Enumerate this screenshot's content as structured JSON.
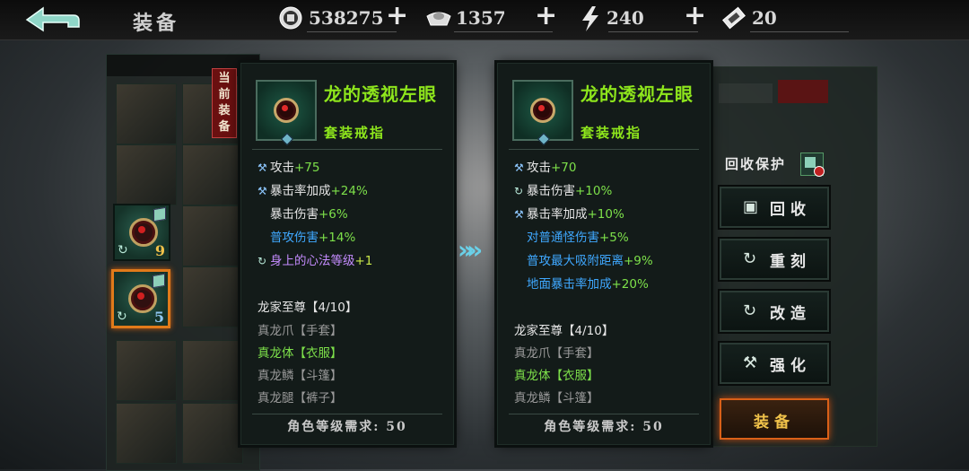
{
  "header": {
    "title": "装备",
    "resources": [
      {
        "icon": "coin-icon",
        "value": "538275"
      },
      {
        "icon": "ingot-icon",
        "value": "1357"
      },
      {
        "icon": "lightning-icon",
        "value": "240"
      },
      {
        "icon": "ticket-icon",
        "value": "20"
      }
    ]
  },
  "equipped_slots": [
    {
      "level": "9"
    },
    {
      "level": "5"
    }
  ],
  "current_tag": [
    "当",
    "前",
    "装",
    "备"
  ],
  "current_item": {
    "name": "龙的透视左眼",
    "type": "套装戒指",
    "stats": [
      {
        "label": "攻击",
        "value": "+75"
      },
      {
        "label": "暴击率加成",
        "value": "+24%"
      },
      {
        "label": "暴击伤害",
        "value": "+6%"
      },
      {
        "label": "普攻伤害",
        "value": "+14%"
      },
      {
        "label": "身上的心法等级",
        "value": "+1"
      }
    ],
    "set_title": "龙家至尊【4/10】",
    "set_items": [
      "真龙爪【手套】",
      "真龙体【衣服】",
      "真龙鳞【斗篷】",
      "真龙腿【裤子】"
    ],
    "requirement": "角色等级需求: 50"
  },
  "compare_item": {
    "name": "龙的透视左眼",
    "type": "套装戒指",
    "stats": [
      {
        "label": "攻击",
        "value": "+70"
      },
      {
        "label": "暴击伤害",
        "value": "+10%"
      },
      {
        "label": "暴击率加成",
        "value": "+10%"
      },
      {
        "label": "对普通怪伤害",
        "value": "+5%"
      },
      {
        "label": "普攻最大吸附距离",
        "value": "+9%"
      },
      {
        "label": "地面暴击率加成",
        "value": "+20%"
      }
    ],
    "set_title": "龙家至尊【4/10】",
    "set_items": [
      "真龙爪【手套】",
      "真龙体【衣服】",
      "真龙鳞【斗篷】"
    ],
    "requirement": "角色等级需求: 50"
  },
  "actions": {
    "protect_label": "回收保护",
    "recycle": "回收",
    "reforge": "重刻",
    "rebuild": "改造",
    "enhance": "强化",
    "equip": "装备"
  },
  "colors": {
    "accent_green": "#8ee61c",
    "stat_blue": "#3fa8ff",
    "equip_orange": "#d96018"
  }
}
